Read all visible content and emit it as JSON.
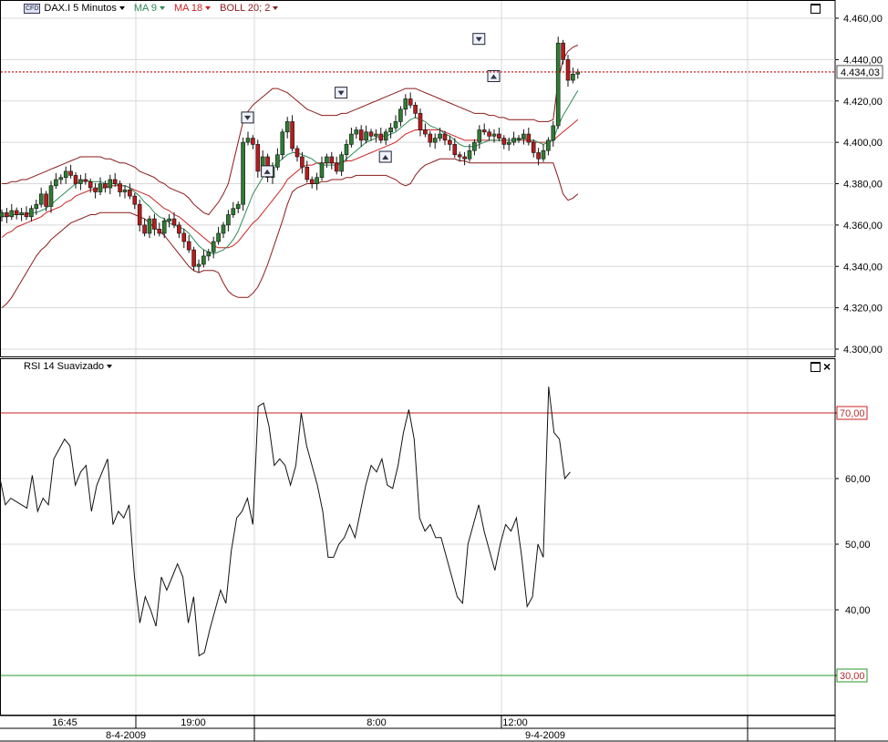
{
  "header": {
    "badge": "CFD",
    "symbol": "DAX.I 5 Minutos",
    "ma1": "MA 9",
    "ma2": "MA 18",
    "boll": "BOLL 20; 2"
  },
  "rsi_header": {
    "label": "RSI 14 Suavizado"
  },
  "price_label": "4.434,03",
  "time_labels": [
    "16:45",
    "19:00",
    "8:00",
    "12:00"
  ],
  "date_labels": [
    "8-4-2009",
    "9-4-2009"
  ],
  "colors": {
    "ma1": "#2e8b57",
    "ma2": "#cc2222",
    "boll": "#8b1a1a",
    "up": "#2e7d32",
    "down": "#b71c1c",
    "price_line": "#cc0000",
    "rsi_high": "#cc2222",
    "rsi_low": "#2a9a2a"
  },
  "chart_data": [
    {
      "type": "candlestick",
      "title": "DAX.I 5 Minutos",
      "ylim": [
        4295,
        4465
      ],
      "y_ticks": [
        "4.460,00",
        "4.440,00",
        "4.420,00",
        "4.400,00",
        "4.380,00",
        "4.360,00",
        "4.340,00",
        "4.320,00",
        "4.300,00"
      ],
      "y_tick_values": [
        4460,
        4440,
        4420,
        4400,
        4380,
        4360,
        4340,
        4320,
        4300
      ],
      "current_price": 4434.03,
      "close": [
        4366,
        4364,
        4367,
        4365,
        4366,
        4364,
        4368,
        4370,
        4375,
        4369,
        4379,
        4382,
        4383,
        4386,
        4384,
        4380,
        4382,
        4381,
        4378,
        4376,
        4380,
        4378,
        4382,
        4380,
        4376,
        4377,
        4374,
        4370,
        4360,
        4356,
        4363,
        4358,
        4356,
        4362,
        4363,
        4360,
        4356,
        4352,
        4348,
        4340,
        4341,
        4345,
        4347,
        4352,
        4356,
        4360,
        4365,
        4368,
        4370,
        4400,
        4402,
        4399,
        4386,
        4393,
        4383,
        4388,
        4394,
        4405,
        4410,
        4397,
        4393,
        4388,
        4382,
        4380,
        4383,
        4390,
        4393,
        4390,
        4386,
        4394,
        4399,
        4404,
        4406,
        4401,
        4405,
        4403,
        4404,
        4401,
        4405,
        4407,
        4410,
        4416,
        4421,
        4418,
        4414,
        4406,
        4404,
        4400,
        4402,
        4404,
        4401,
        4399,
        4394,
        4393,
        4392,
        4396,
        4400,
        4406,
        4405,
        4403,
        4404,
        4402,
        4399,
        4400,
        4402,
        4402,
        4404,
        4400,
        4395,
        4392,
        4396,
        4401,
        4408,
        4448,
        4440,
        4430,
        4433,
        4434.03
      ],
      "ma9": [
        4364,
        4364,
        4365,
        4365,
        4365,
        4365,
        4366,
        4366,
        4367,
        4368,
        4370,
        4372,
        4374,
        4376,
        4378,
        4380,
        4381,
        4382,
        4381,
        4381,
        4381,
        4380,
        4380,
        4380,
        4379,
        4379,
        4378,
        4376,
        4374,
        4371,
        4369,
        4366,
        4364,
        4363,
        4361,
        4360,
        4359,
        4358,
        4356,
        4353,
        4350,
        4348,
        4347,
        4346,
        4347,
        4348,
        4350,
        4353,
        4357,
        4363,
        4369,
        4375,
        4379,
        4383,
        4386,
        4388,
        4390,
        4392,
        4394,
        4395,
        4395,
        4394,
        4393,
        4392,
        4390,
        4389,
        4389,
        4389,
        4389,
        4390,
        4392,
        4394,
        4396,
        4398,
        4400,
        4401,
        4402,
        4403,
        4403,
        4404,
        4405,
        4407,
        4409,
        4411,
        4412,
        4411,
        4410,
        4408,
        4407,
        4406,
        4404,
        4403,
        4401,
        4399,
        4398,
        4398,
        4398,
        4399,
        4400,
        4401,
        4401,
        4401,
        4401,
        4401,
        4401,
        4401,
        4402,
        4401,
        4401,
        4400,
        4399,
        4400,
        4401,
        4408,
        4413,
        4417,
        4421,
        4425
      ],
      "ma18": [
        4354,
        4356,
        4357,
        4359,
        4360,
        4361,
        4362,
        4363,
        4364,
        4366,
        4367,
        4368,
        4369,
        4371,
        4372,
        4374,
        4375,
        4376,
        4377,
        4377,
        4378,
        4378,
        4379,
        4379,
        4379,
        4379,
        4378,
        4377,
        4376,
        4375,
        4374,
        4372,
        4370,
        4368,
        4367,
        4365,
        4364,
        4362,
        4360,
        4358,
        4356,
        4354,
        4352,
        4350,
        4349,
        4349,
        4349,
        4350,
        4352,
        4355,
        4358,
        4361,
        4363,
        4366,
        4369,
        4372,
        4375,
        4378,
        4382,
        4384,
        4386,
        4388,
        4389,
        4389,
        4390,
        4390,
        4390,
        4390,
        4390,
        4390,
        4391,
        4391,
        4392,
        4393,
        4394,
        4395,
        4396,
        4397,
        4398,
        4399,
        4400,
        4402,
        4404,
        4405,
        4406,
        4406,
        4406,
        4406,
        4406,
        4406,
        4405,
        4404,
        4403,
        4402,
        4401,
        4401,
        4401,
        4401,
        4401,
        4401,
        4401,
        4401,
        4401,
        4401,
        4401,
        4401,
        4401,
        4401,
        4400,
        4400,
        4400,
        4400,
        4401,
        4403,
        4405,
        4407,
        4409,
        4411
      ],
      "boll_upper": [
        4380,
        4380,
        4381,
        4381,
        4382,
        4382,
        4383,
        4384,
        4385,
        4386,
        4387,
        4388,
        4389,
        4390,
        4391,
        4392,
        4393,
        4393,
        4393,
        4393,
        4393,
        4392,
        4392,
        4391,
        4390,
        4390,
        4389,
        4388,
        4386,
        4385,
        4384,
        4383,
        4381,
        4380,
        4378,
        4377,
        4376,
        4375,
        4373,
        4370,
        4368,
        4366,
        4365,
        4368,
        4371,
        4375,
        4380,
        4390,
        4400,
        4410,
        4415,
        4418,
        4420,
        4422,
        4424,
        4426,
        4426,
        4425,
        4424,
        4422,
        4420,
        4418,
        4416,
        4415,
        4414,
        4413,
        4413,
        4413,
        4413,
        4414,
        4414,
        4415,
        4416,
        4417,
        4418,
        4419,
        4420,
        4421,
        4422,
        4423,
        4424,
        4425,
        4426,
        4426,
        4426,
        4425,
        4424,
        4423,
        4422,
        4421,
        4420,
        4419,
        4418,
        4417,
        4416,
        4415,
        4414,
        4414,
        4414,
        4413,
        4413,
        4412,
        4412,
        4411,
        4411,
        4411,
        4411,
        4411,
        4411,
        4410,
        4410,
        4410,
        4411,
        4430,
        4440,
        4444,
        4446,
        4447
      ],
      "boll_lower": [
        4320,
        4322,
        4325,
        4329,
        4333,
        4337,
        4341,
        4345,
        4348,
        4350,
        4353,
        4355,
        4357,
        4359,
        4361,
        4362,
        4363,
        4364,
        4365,
        4365,
        4366,
        4366,
        4366,
        4366,
        4366,
        4366,
        4366,
        4365,
        4364,
        4363,
        4361,
        4359,
        4357,
        4355,
        4352,
        4349,
        4346,
        4343,
        4340,
        4338,
        4337,
        4338,
        4338,
        4338,
        4337,
        4332,
        4328,
        4326,
        4325,
        4325,
        4325,
        4327,
        4330,
        4335,
        4341,
        4348,
        4355,
        4362,
        4370,
        4376,
        4378,
        4379,
        4380,
        4380,
        4380,
        4381,
        4381,
        4382,
        4382,
        4382,
        4383,
        4383,
        4384,
        4384,
        4384,
        4384,
        4384,
        4384,
        4384,
        4383,
        4382,
        4380,
        4379,
        4380,
        4384,
        4387,
        4389,
        4390,
        4391,
        4392,
        4392,
        4392,
        4392,
        4391,
        4391,
        4390,
        4390,
        4390,
        4390,
        4390,
        4390,
        4390,
        4390,
        4390,
        4390,
        4390,
        4390,
        4390,
        4390,
        4390,
        4390,
        4390,
        4390,
        4383,
        4375,
        4372,
        4373,
        4375
      ]
    },
    {
      "type": "line",
      "title": "RSI 14 Suavizado",
      "ylim": [
        21,
        77
      ],
      "y_ticks": [
        "70,00",
        "60,00",
        "50,00",
        "40,00",
        "30,00"
      ],
      "y_tick_values": [
        70,
        60,
        50,
        40,
        30
      ],
      "high_level": 70,
      "low_level": 30,
      "values": [
        60,
        56,
        57,
        56.5,
        56,
        55.5,
        60.5,
        55,
        57,
        56,
        63,
        64.5,
        66,
        65,
        59,
        61,
        62,
        55,
        59,
        61,
        63,
        53,
        55,
        54,
        56,
        45,
        38,
        42,
        40,
        37.5,
        45,
        43,
        45,
        47,
        45,
        38,
        42,
        33,
        33.5,
        37,
        40,
        43,
        41,
        49,
        54,
        55,
        57,
        53,
        71,
        71.5,
        68,
        62,
        63,
        62,
        59,
        62,
        70,
        65,
        62,
        59,
        55,
        48,
        48,
        50,
        51,
        53,
        51,
        55,
        59,
        62,
        61,
        63,
        59,
        58.5,
        62,
        67,
        70.5,
        66,
        54,
        52,
        53,
        51,
        51,
        48,
        45,
        42,
        41,
        50,
        53,
        56,
        52,
        49,
        46,
        50,
        53,
        52,
        54,
        48,
        40.5,
        42,
        50,
        48,
        74,
        67,
        66,
        60,
        61
      ],
      "markers": [
        {
          "type": "sell",
          "index": 50,
          "price": 4412
        },
        {
          "type": "buy",
          "index": 54,
          "price": 4386
        },
        {
          "type": "sell",
          "index": 69,
          "price": 4424
        },
        {
          "type": "buy",
          "index": 78,
          "price": 4393
        },
        {
          "type": "sell",
          "index": 97,
          "price": 4450
        },
        {
          "type": "buy",
          "index": 100,
          "price": 4432
        }
      ]
    }
  ]
}
